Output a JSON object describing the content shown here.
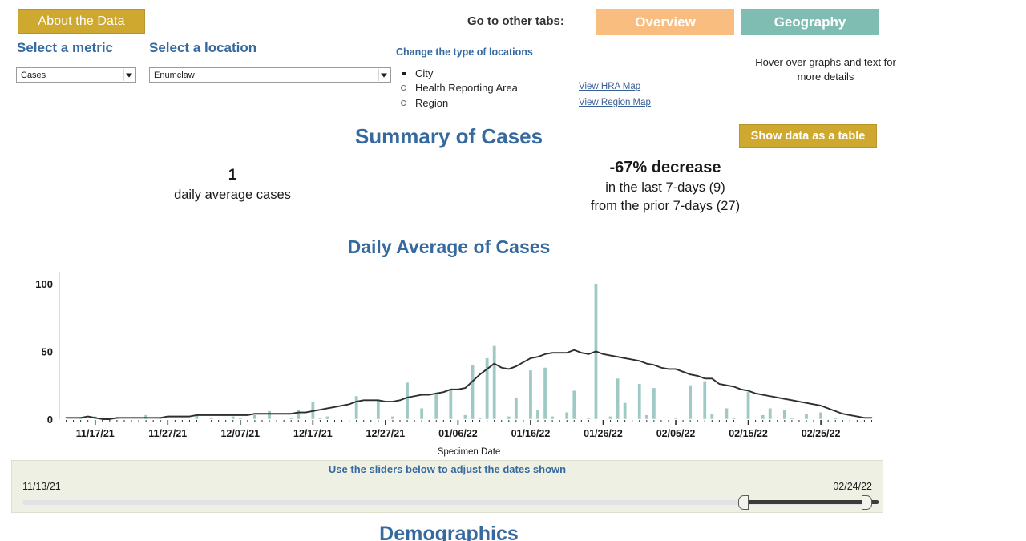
{
  "header": {
    "about_button": "About the Data",
    "goto_label": "Go to other tabs:",
    "tab_overview": "Overview",
    "tab_geography": "Geography",
    "hover_note": "Hover over graphs and text for more details"
  },
  "controls": {
    "metric_label": "Select a metric",
    "location_label": "Select a location",
    "metric_value": "Cases",
    "location_value": "Enumclaw",
    "location_type_label": "Change the type of locations",
    "location_types": [
      {
        "label": "City",
        "selected": true
      },
      {
        "label": "Health Reporting Area",
        "selected": false
      },
      {
        "label": "Region",
        "selected": false
      }
    ],
    "hra_map_link": "View HRA Map",
    "region_map_link": "View Region Map"
  },
  "summary": {
    "title": "Summary of Cases",
    "show_table_button": "Show data as a table",
    "daily_avg_value": "1",
    "daily_avg_label": "daily average cases",
    "change_headline": "-67% decrease",
    "change_line1": "in the last 7-days (9)",
    "change_line2": "from the prior 7-days (27)"
  },
  "slider": {
    "title": "Use the sliders below to adjust the dates shown",
    "start_date": "11/13/21",
    "end_date": "02/24/22"
  },
  "footer": {
    "demographics_title": "Demographics"
  },
  "colors": {
    "brand_blue": "#36699e",
    "gold": "#cfa82f",
    "tab_orange": "#f8bd7f",
    "tab_teal": "#7fbcb2",
    "bar_teal": "#9ec9c4",
    "avg_line": "#2e2e2e",
    "panel_bg": "#eef0e3"
  },
  "chart_data": {
    "type": "bar",
    "title": "Daily Average of Cases",
    "xlabel": "Specimen Date",
    "ylabel": "",
    "ylim": [
      0,
      110
    ],
    "yticks": [
      0,
      50,
      100
    ],
    "ytick_labels": [
      "0",
      "50",
      "100"
    ],
    "grid": false,
    "x_tick_labels": [
      "11/17/21",
      "11/27/21",
      "12/07/21",
      "12/17/21",
      "12/27/21",
      "01/06/22",
      "01/16/22",
      "01/26/22",
      "02/05/22",
      "02/15/22",
      "02/25/22"
    ],
    "x_tick_indices": [
      4,
      14,
      24,
      34,
      44,
      54,
      64,
      74,
      84,
      94,
      104
    ],
    "x_start_date": "11/13/21",
    "x_end_date": "02/26/22",
    "series": [
      {
        "name": "Daily cases",
        "type": "bar",
        "color": "#9ec9c4",
        "values": [
          0,
          0,
          1,
          0,
          2,
          0,
          0,
          1,
          0,
          0,
          0,
          3,
          0,
          1,
          0,
          0,
          0,
          0,
          4,
          0,
          1,
          0,
          0,
          2,
          1,
          0,
          3,
          0,
          6,
          0,
          0,
          1,
          7,
          0,
          13,
          1,
          2,
          0,
          0,
          0,
          17,
          0,
          0,
          14,
          0,
          2,
          0,
          27,
          0,
          8,
          0,
          19,
          0,
          22,
          0,
          3,
          40,
          1,
          45,
          54,
          0,
          2,
          16,
          0,
          36,
          7,
          38,
          2,
          0,
          5,
          21,
          0,
          1,
          100,
          0,
          2,
          30,
          12,
          0,
          26,
          3,
          23,
          0,
          0,
          1,
          0,
          25,
          0,
          28,
          4,
          0,
          8,
          1,
          0,
          20,
          0,
          3,
          8,
          0,
          7,
          1,
          0,
          4,
          0,
          5,
          0,
          1,
          0,
          0,
          0,
          0,
          0
        ]
      },
      {
        "name": "7-day average",
        "type": "line",
        "color": "#2e2e2e",
        "values": [
          1,
          1,
          1,
          2,
          1,
          0,
          0,
          1,
          1,
          1,
          1,
          1,
          1,
          1,
          2,
          2,
          2,
          2,
          3,
          3,
          3,
          3,
          3,
          3,
          3,
          3,
          4,
          4,
          4,
          4,
          4,
          4,
          5,
          5,
          6,
          7,
          8,
          9,
          10,
          11,
          13,
          14,
          14,
          14,
          13,
          13,
          14,
          16,
          17,
          18,
          18,
          19,
          20,
          22,
          22,
          23,
          28,
          33,
          37,
          41,
          38,
          37,
          39,
          42,
          45,
          46,
          48,
          49,
          49,
          49,
          51,
          49,
          48,
          50,
          48,
          47,
          46,
          45,
          44,
          43,
          41,
          40,
          38,
          37,
          37,
          35,
          33,
          32,
          30,
          30,
          26,
          25,
          24,
          22,
          21,
          19,
          18,
          17,
          16,
          15,
          14,
          13,
          12,
          11,
          10,
          8,
          6,
          4,
          3,
          2,
          1,
          1
        ]
      }
    ]
  }
}
